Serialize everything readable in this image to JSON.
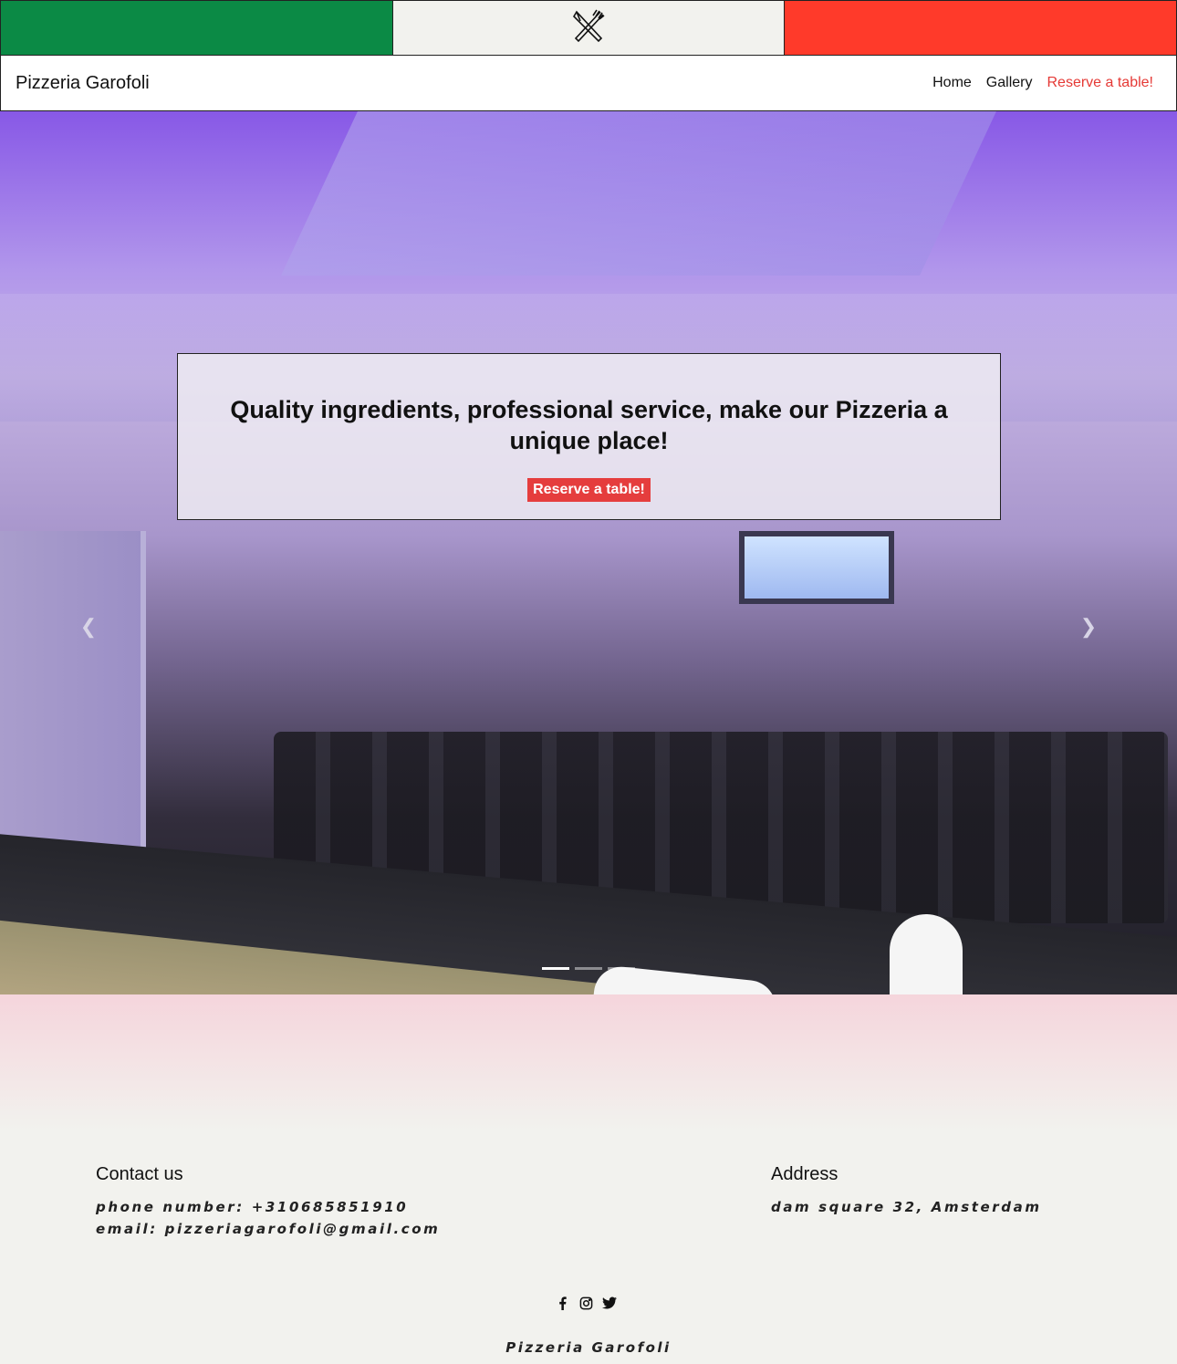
{
  "brand": "Pizzeria Garofoli",
  "nav": {
    "home": "Home",
    "gallery": "Gallery",
    "reserve": "Reserve a table!"
  },
  "hero": {
    "headline": "Quality ingredients, professional service, make our Pizzeria a unique place!",
    "cta": "Reserve a table!",
    "slides_count": 3,
    "active_slide": 1
  },
  "contact": {
    "heading": "Contact us",
    "phone": "phone number: +310685851910",
    "email": "email: pizzeriagarofoli@gmail.com"
  },
  "address": {
    "heading": "Address",
    "line": "dam square 32, Amsterdam"
  },
  "social": {
    "icons": [
      "facebook-icon",
      "instagram-icon",
      "twitter-icon"
    ]
  },
  "footer": {
    "brand": "Pizzeria Garofoli"
  },
  "colors": {
    "flag_green": "#0b8a45",
    "flag_white": "#f2f2ee",
    "flag_red": "#ff3a2a",
    "accent": "#e53935"
  }
}
